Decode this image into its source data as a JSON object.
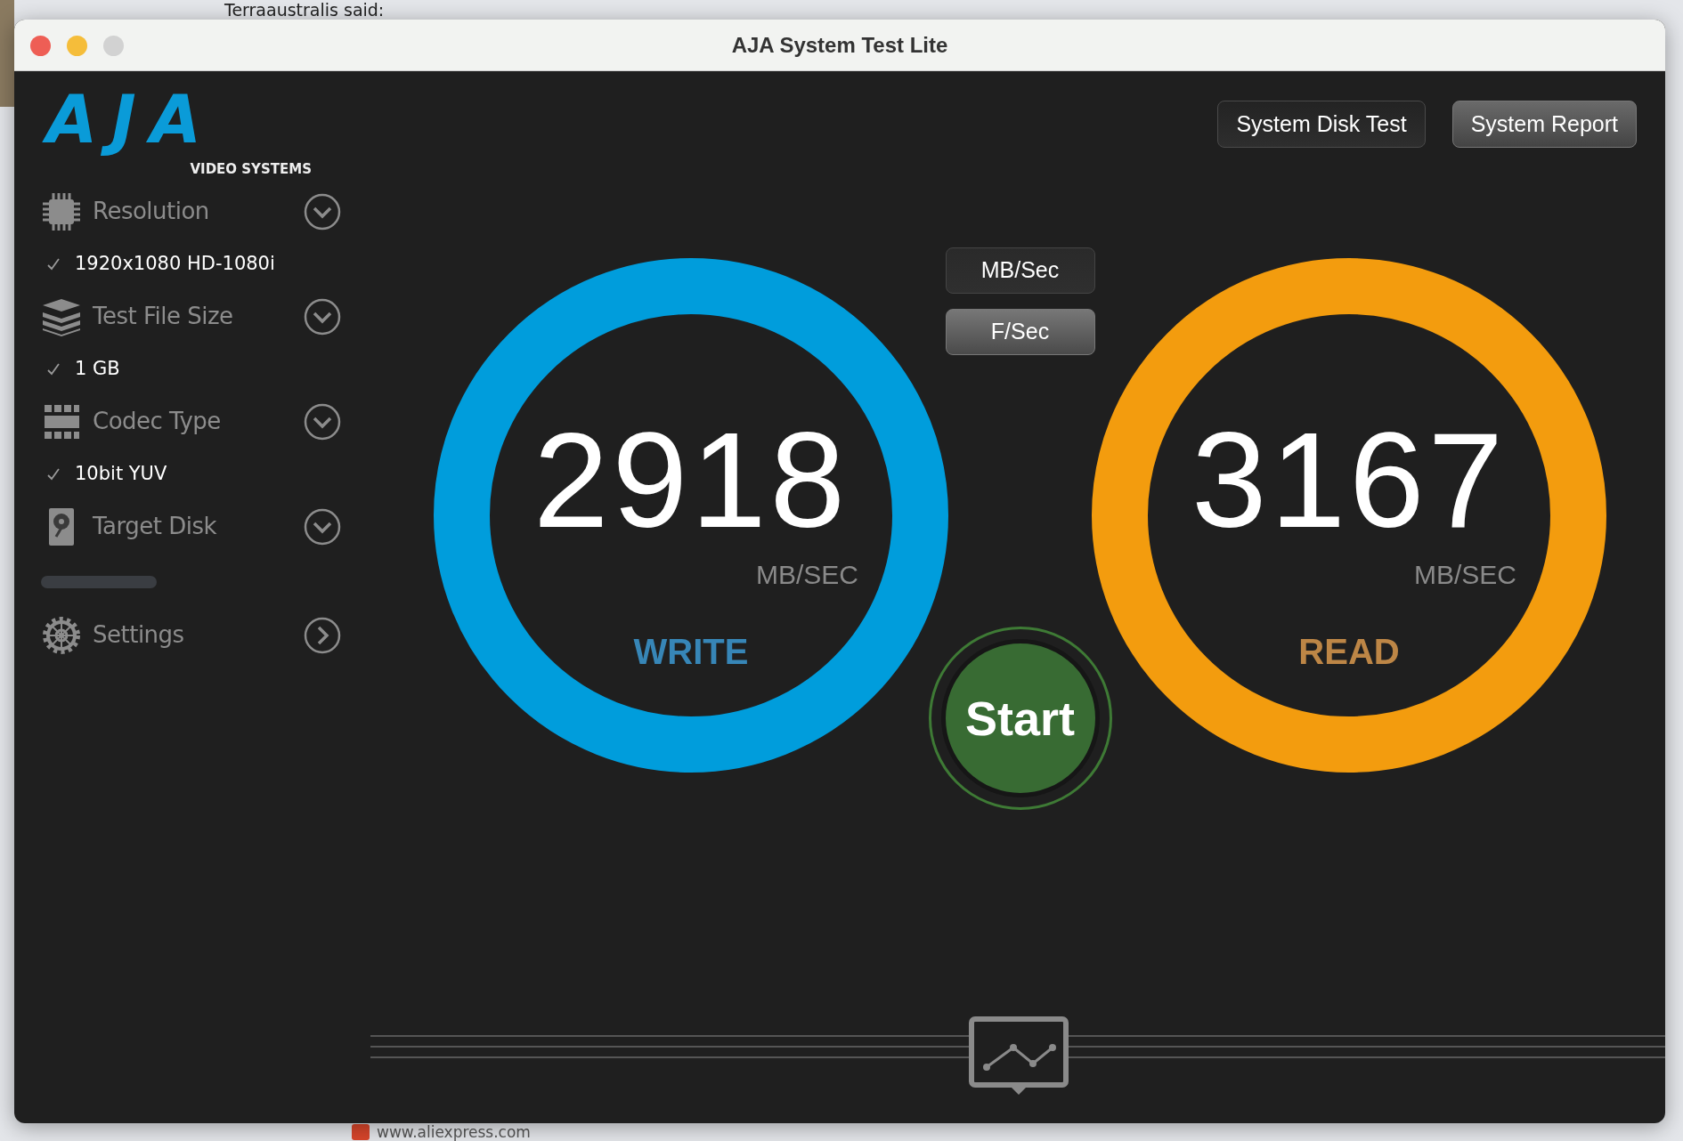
{
  "background": {
    "post_author": "Terraaustralis said:",
    "link_domain": "www.aliexpress.com"
  },
  "window": {
    "title": "AJA System Test Lite"
  },
  "logo": {
    "name": "AJA",
    "tagline": "VIDEO SYSTEMS"
  },
  "sidebar": {
    "sections": [
      {
        "label": "Resolution",
        "kind": "dropdown",
        "value": "1920x1080 HD-1080i",
        "checked": true
      },
      {
        "label": "Test File Size",
        "kind": "dropdown",
        "value": "1 GB",
        "checked": true
      },
      {
        "label": "Codec Type",
        "kind": "dropdown",
        "value": "10bit YUV",
        "checked": true
      },
      {
        "label": "Target Disk",
        "kind": "dropdown"
      },
      {
        "kind": "progress",
        "level": 0
      },
      {
        "label": "Settings",
        "kind": "link"
      }
    ]
  },
  "toolbar": {
    "buttons": [
      {
        "label": "System Disk Test",
        "highlighted": false
      },
      {
        "label": "System Report",
        "highlighted": true
      }
    ]
  },
  "units": [
    {
      "label": "MB/Sec",
      "selected": true
    },
    {
      "label": "F/Sec",
      "selected": false
    }
  ],
  "gauges": [
    {
      "value": "2918",
      "unit": "MB/SEC",
      "label": "WRITE",
      "color": "#009ddc"
    },
    {
      "value": "3167",
      "unit": "MB/SEC",
      "label": "READ",
      "color": "#f39c0e"
    }
  ],
  "start_button": {
    "label": "Start"
  }
}
